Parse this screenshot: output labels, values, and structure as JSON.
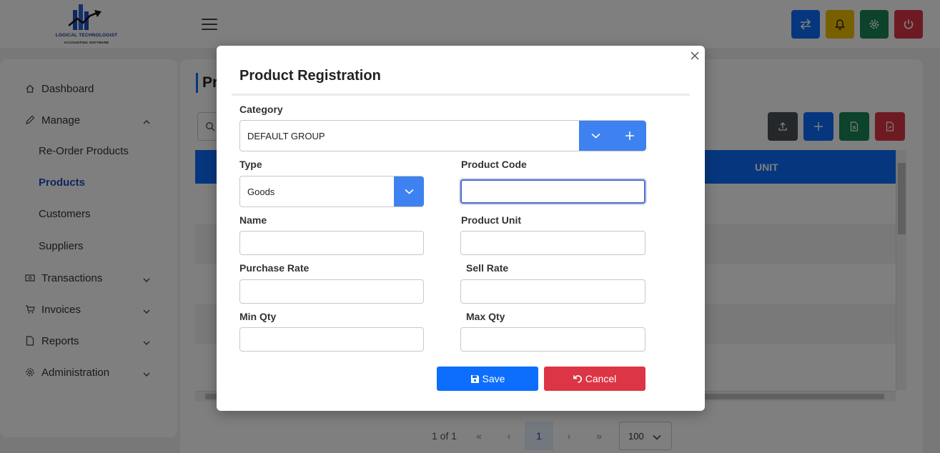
{
  "app": {
    "brand": "LOGICAL TECHNOLOGIST",
    "brand_sub": "ACCOUNTING SOFTWARE"
  },
  "topbar": {
    "buttons": [
      {
        "icon": "transfer-icon",
        "color": "#0d6efd"
      },
      {
        "icon": "bell-icon",
        "color": "#f0c000"
      },
      {
        "icon": "gear-icon",
        "color": "#198754"
      },
      {
        "icon": "power-icon",
        "color": "#dc3545"
      }
    ]
  },
  "sidebar": {
    "items": [
      {
        "label": "Dashboard",
        "icon": "home-icon"
      },
      {
        "label": "Manage",
        "icon": "pencil-icon",
        "expanded": true
      },
      {
        "label": "Transactions",
        "icon": "cash-icon"
      },
      {
        "label": "Invoices",
        "icon": "cart-icon"
      },
      {
        "label": "Reports",
        "icon": "report-icon"
      },
      {
        "label": "Administration",
        "icon": "gear-icon"
      }
    ],
    "sub_items": [
      {
        "label": "Re-Order Products"
      },
      {
        "label": "Products",
        "active": true
      },
      {
        "label": "Customers"
      },
      {
        "label": "Suppliers"
      }
    ]
  },
  "page": {
    "title": "Pr",
    "table_header_unit": "UNIT",
    "pager": {
      "info": "1 of 1",
      "current_page": "1",
      "page_size": "100"
    }
  },
  "modal": {
    "title": "Product Registration",
    "category_label": "Category",
    "category_value": "DEFAULT GROUP",
    "type_label": "Type",
    "type_value": "Goods",
    "product_code_label": "Product Code",
    "product_code_value": "",
    "name_label": "Name",
    "name_value": "",
    "product_unit_label": "Product Unit",
    "product_unit_value": "",
    "purchase_rate_label": "Purchase Rate",
    "purchase_rate_value": "",
    "sell_rate_label": "Sell Rate",
    "sell_rate_value": "",
    "min_qty_label": "Min Qty",
    "min_qty_value": "",
    "max_qty_label": "Max Qty",
    "max_qty_value": "",
    "save_label": "Save",
    "cancel_label": "Cancel"
  },
  "colors": {
    "primary": "#0d6efd",
    "danger": "#dc3545",
    "success": "#198754",
    "warning": "#f0c000",
    "select_button": "#3d82f0"
  }
}
